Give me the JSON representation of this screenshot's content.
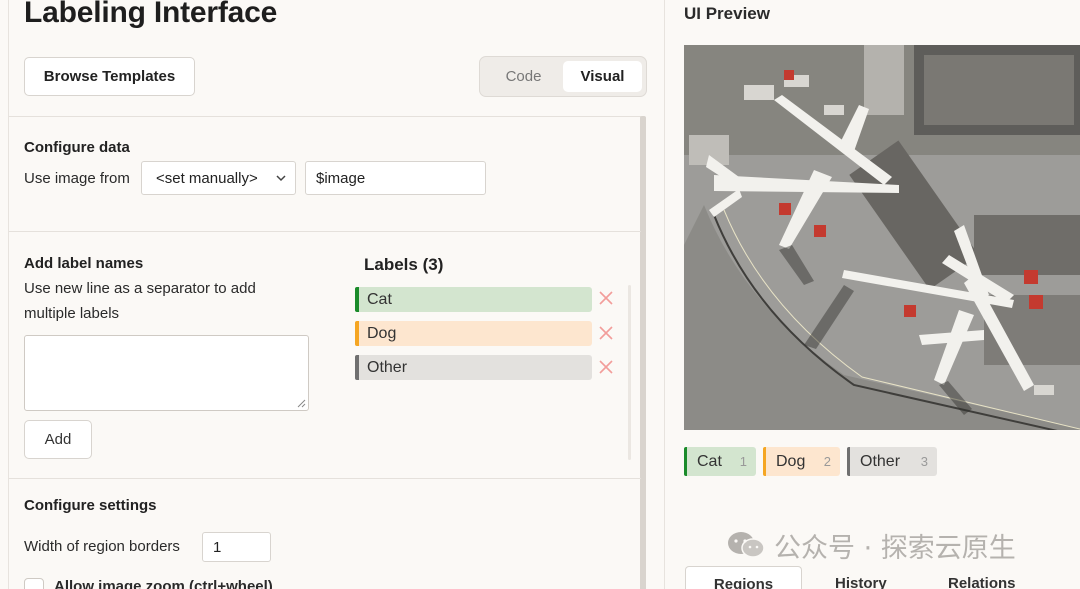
{
  "left": {
    "title": "Labeling Interface",
    "browse_templates": "Browse Templates",
    "mode_toggle": {
      "code": "Code",
      "visual": "Visual",
      "active": "Visual"
    },
    "configure_data": {
      "title": "Configure data",
      "use_image_from_label": "Use image from",
      "source_select": "<set manually>",
      "variable_value": "$image"
    },
    "add_labels": {
      "title": "Add label names",
      "hint_line1": "Use new line as a separator to add",
      "hint_line2": "multiple labels",
      "textarea_value": "",
      "add_button": "Add"
    },
    "labels": {
      "heading": "Labels (3)",
      "items": [
        {
          "name": "Cat",
          "color": "#1a8b2a",
          "bg": "#d3e5cf"
        },
        {
          "name": "Dog",
          "color": "#f5a623",
          "bg": "#fde6cf"
        },
        {
          "name": "Other",
          "color": "#707070",
          "bg": "#e3e1de"
        }
      ]
    },
    "configure_settings": {
      "title": "Configure settings",
      "border_width_label": "Width of region borders",
      "border_width_value": "1",
      "zoom_label": "Allow image zoom (ctrl+wheel)"
    }
  },
  "right": {
    "title": "UI Preview",
    "chips": [
      {
        "name": "Cat",
        "hotkey": "1",
        "color": "#1a8b2a",
        "bg": "#d3e5cf"
      },
      {
        "name": "Dog",
        "hotkey": "2",
        "color": "#f5a623",
        "bg": "#fde6cf"
      },
      {
        "name": "Other",
        "hotkey": "3",
        "color": "#707070",
        "bg": "#e3e1de"
      }
    ],
    "tabs": [
      "Regions",
      "History",
      "Relations"
    ],
    "watermark": "公众号 · 探索云原生"
  }
}
